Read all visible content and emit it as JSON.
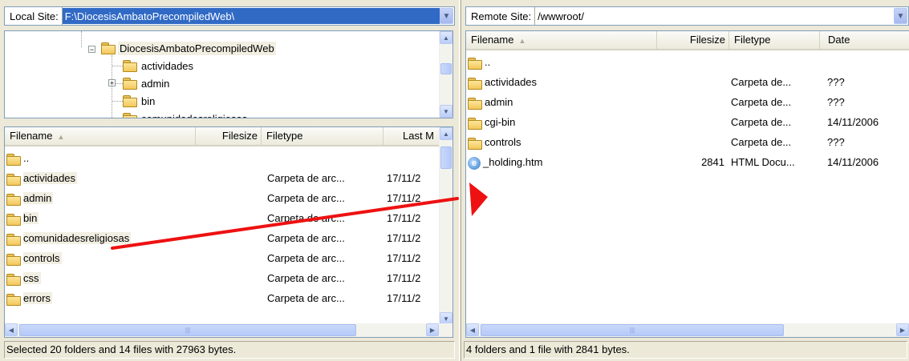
{
  "local": {
    "site_label": "Local Site:",
    "site_path": "F:\\DiocesisAmbatoPrecompiledWeb\\",
    "tree": {
      "root": "DiocesisAmbatoPrecompiledWeb",
      "children": [
        "actividades",
        "admin",
        "bin",
        "comunidadesreligiosas"
      ]
    },
    "columns": {
      "filename": "Filename",
      "filesize": "Filesize",
      "filetype": "Filetype",
      "last_modified": "Last M"
    },
    "files": [
      {
        "name": "..",
        "size": "",
        "type": "",
        "date": ""
      },
      {
        "name": "actividades",
        "size": "",
        "type": "Carpeta de arc...",
        "date": "17/11/2"
      },
      {
        "name": "admin",
        "size": "",
        "type": "Carpeta de arc...",
        "date": "17/11/2"
      },
      {
        "name": "bin",
        "size": "",
        "type": "Carpeta de arc...",
        "date": "17/11/2"
      },
      {
        "name": "comunidadesreligiosas",
        "size": "",
        "type": "Carpeta de arc...",
        "date": "17/11/2"
      },
      {
        "name": "controls",
        "size": "",
        "type": "Carpeta de arc...",
        "date": "17/11/2"
      },
      {
        "name": "css",
        "size": "",
        "type": "Carpeta de arc...",
        "date": "17/11/2"
      },
      {
        "name": "errors",
        "size": "",
        "type": "Carpeta de arc...",
        "date": "17/11/2"
      }
    ],
    "status": "Selected 20 folders and 14 files with 27963 bytes."
  },
  "remote": {
    "site_label": "Remote Site:",
    "site_path": "/wwwroot/",
    "columns": {
      "filename": "Filename",
      "filesize": "Filesize",
      "filetype": "Filetype",
      "date": "Date"
    },
    "files": [
      {
        "name": "..",
        "size": "",
        "type": "",
        "date": "",
        "icon": "folder"
      },
      {
        "name": "actividades",
        "size": "",
        "type": "Carpeta de...",
        "date": "???",
        "icon": "folder"
      },
      {
        "name": "admin",
        "size": "",
        "type": "Carpeta de...",
        "date": "???",
        "icon": "folder"
      },
      {
        "name": "cgi-bin",
        "size": "",
        "type": "Carpeta de...",
        "date": "14/11/2006",
        "icon": "folder"
      },
      {
        "name": "controls",
        "size": "",
        "type": "Carpeta de...",
        "date": "???",
        "icon": "folder"
      },
      {
        "name": "_holding.htm",
        "size": "2841",
        "type": "HTML Docu...",
        "date": "14/11/2006",
        "icon": "ie-html"
      }
    ],
    "status": "4 folders and 1 file with 2841 bytes."
  },
  "annotation": {
    "color": "#ee1111",
    "meaning": "drag arrow"
  }
}
